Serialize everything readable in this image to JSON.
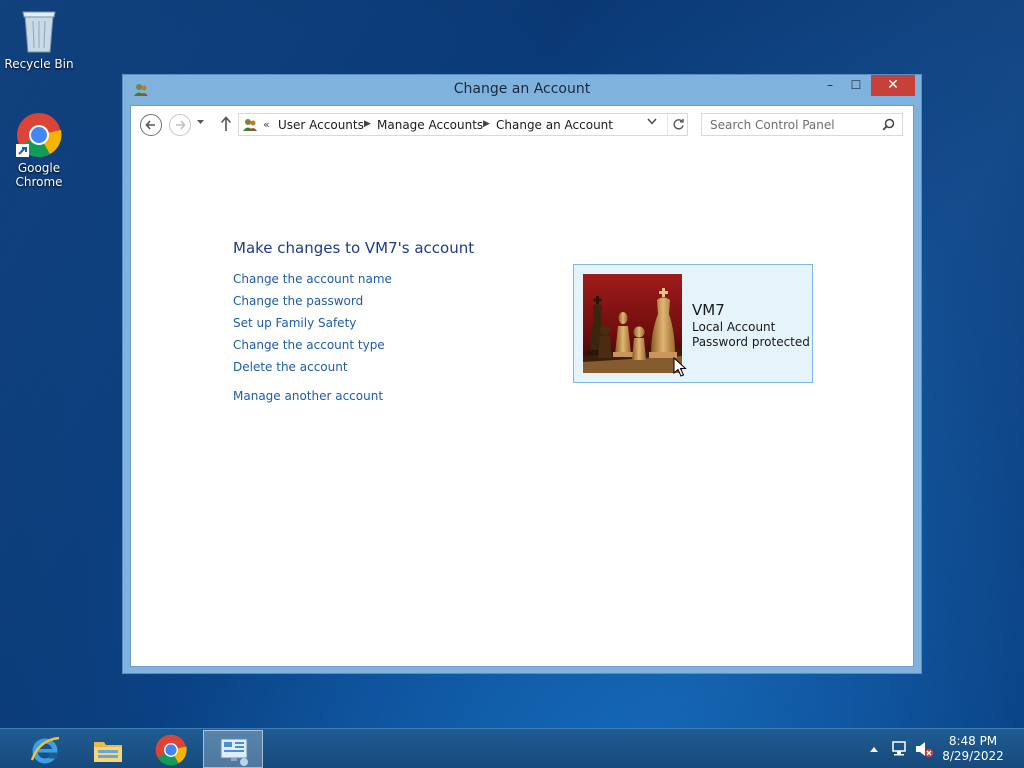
{
  "desktop": {
    "icons": [
      {
        "label": "Recycle Bin"
      },
      {
        "label": "Google Chrome"
      }
    ]
  },
  "window": {
    "title": "Change an Account",
    "buttons": {
      "minimize": "–",
      "maximize": "☐",
      "close": "✕"
    }
  },
  "address_bar": {
    "prefix": "«",
    "crumbs": [
      "User Accounts",
      "Manage Accounts",
      "Change an Account"
    ]
  },
  "search": {
    "placeholder": "Search Control Panel"
  },
  "content": {
    "heading": "Make changes to VM7's account",
    "tasks": [
      "Change the account name",
      "Change the password",
      "Set up Family Safety",
      "Change the account type",
      "Delete the account"
    ],
    "manage_other": "Manage another account"
  },
  "account": {
    "name": "VM7",
    "type": "Local Account",
    "status": "Password protected"
  },
  "taskbar": {
    "time": "8:48 PM",
    "date": "8/29/2022"
  },
  "colors": {
    "link": "#1e5ca8",
    "heading": "#1e3b8a",
    "window_frame": "#7fb2dd",
    "close_button": "#c7403a"
  }
}
